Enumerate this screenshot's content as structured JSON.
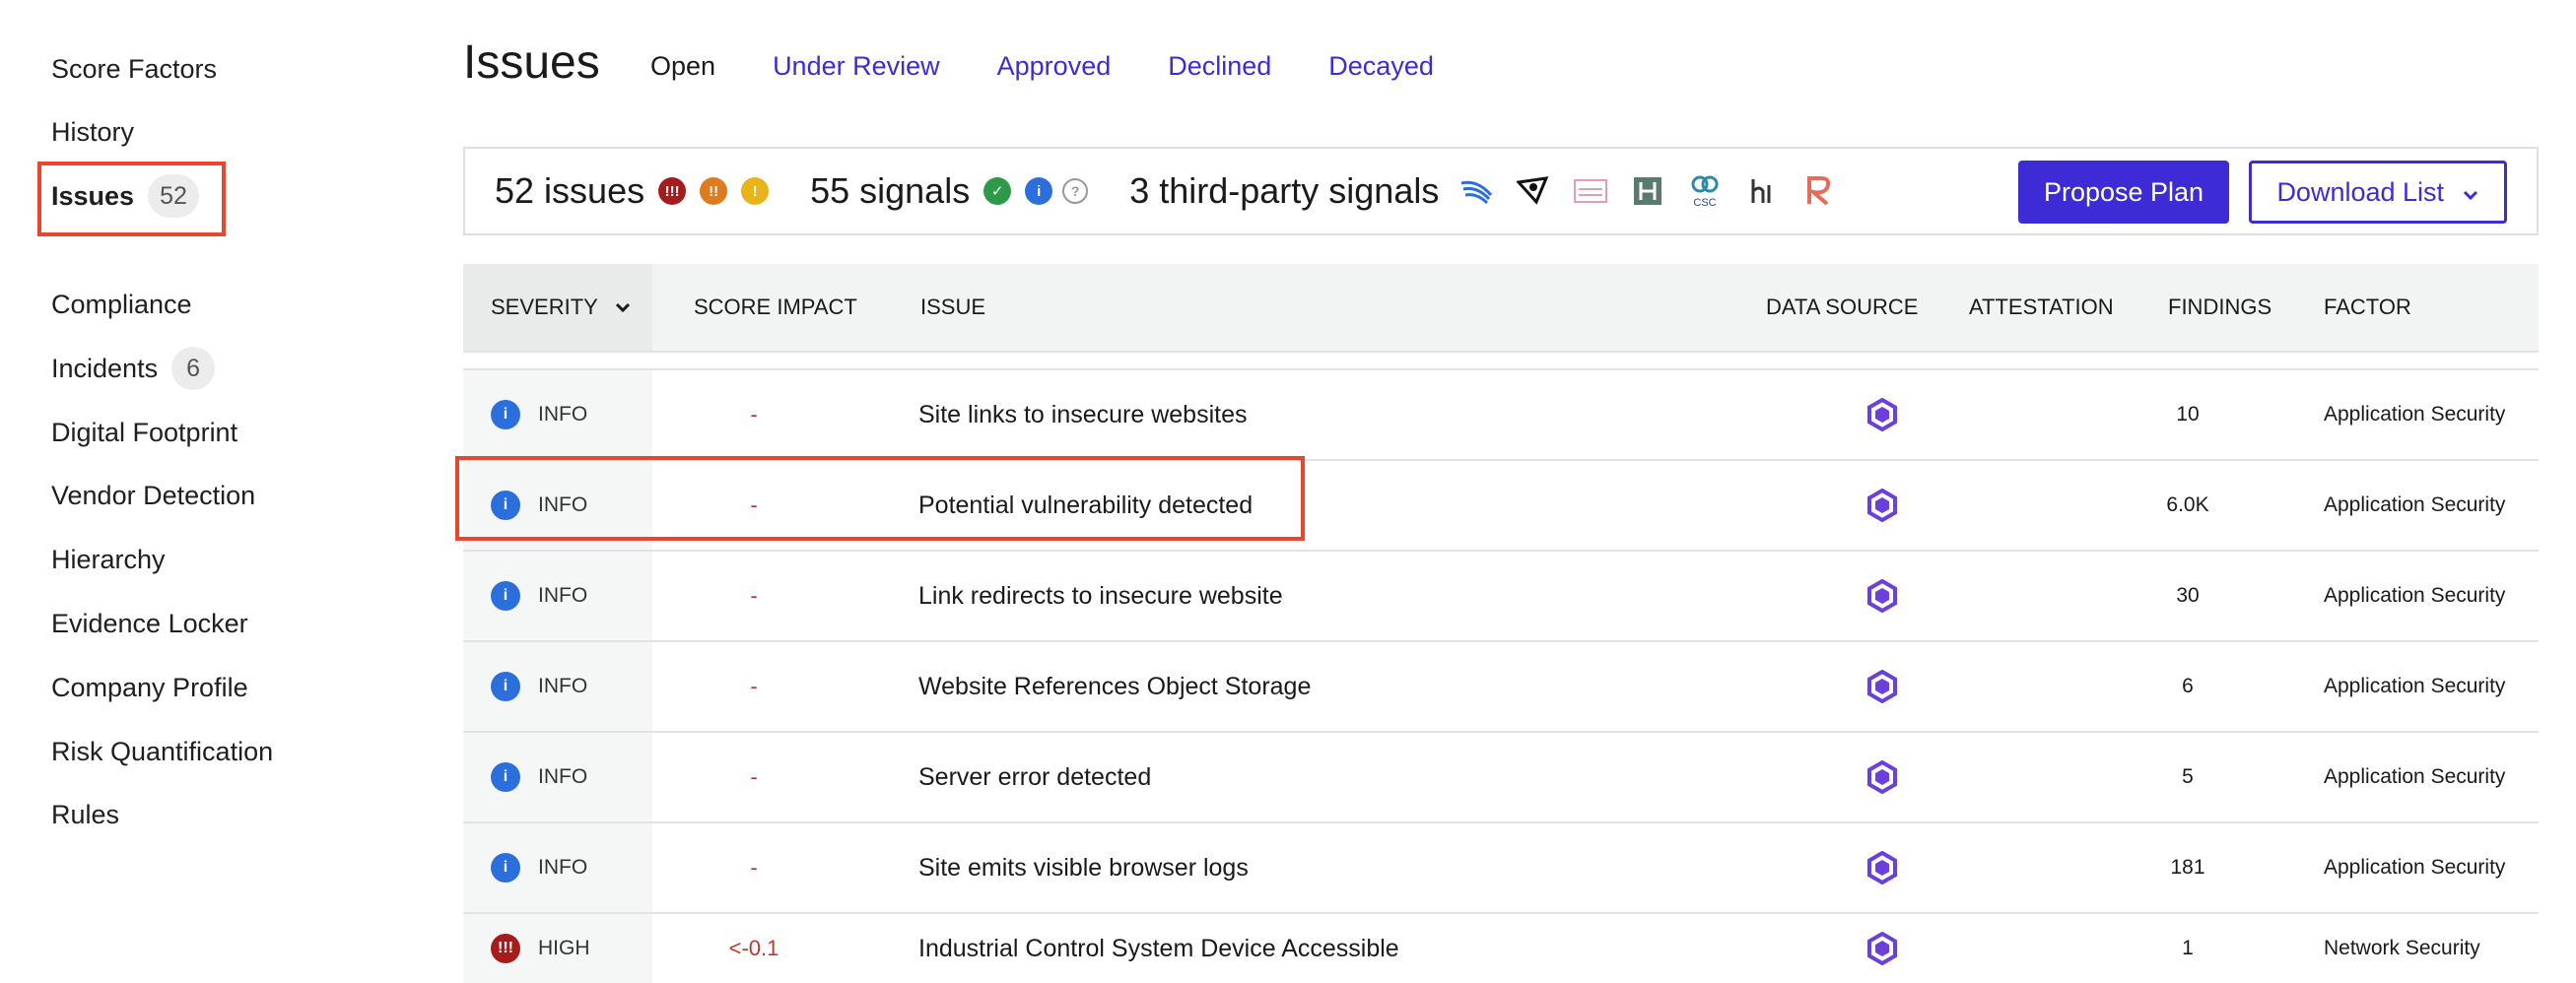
{
  "sidebar": {
    "items": [
      {
        "label": "Score Factors"
      },
      {
        "label": "History"
      },
      {
        "label": "Issues",
        "badge": "52"
      },
      {
        "label": "Compliance"
      },
      {
        "label": "Incidents",
        "badge": "6"
      },
      {
        "label": "Digital Footprint"
      },
      {
        "label": "Vendor Detection"
      },
      {
        "label": "Hierarchy"
      },
      {
        "label": "Evidence Locker"
      },
      {
        "label": "Company Profile"
      },
      {
        "label": "Risk Quantification"
      },
      {
        "label": "Rules"
      }
    ]
  },
  "header": {
    "title": "Issues",
    "tabs": [
      "Open",
      "Under Review",
      "Approved",
      "Declined",
      "Decayed"
    ]
  },
  "summary": {
    "issues": "52 issues",
    "signals": "55 signals",
    "third_party": "3 third-party signals",
    "propose_label": "Propose Plan",
    "download_label": "Download List"
  },
  "table": {
    "headers": {
      "severity": "SEVERITY",
      "impact": "SCORE IMPACT",
      "issue": "ISSUE",
      "source": "DATA SOURCE",
      "attestation": "ATTESTATION",
      "findings": "FINDINGS",
      "factor": "FACTOR"
    },
    "rows": [
      {
        "severity": "INFO",
        "impact": "-",
        "issue": "Site links to insecure websites",
        "findings": "10",
        "factor": "Application Security"
      },
      {
        "severity": "INFO",
        "impact": "-",
        "issue": "Potential vulnerability detected",
        "findings": "6.0K",
        "factor": "Application Security"
      },
      {
        "severity": "INFO",
        "impact": "-",
        "issue": "Link redirects to insecure website",
        "findings": "30",
        "factor": "Application Security"
      },
      {
        "severity": "INFO",
        "impact": "-",
        "issue": "Website References Object Storage",
        "findings": "6",
        "factor": "Application Security"
      },
      {
        "severity": "INFO",
        "impact": "-",
        "issue": "Server error detected",
        "findings": "5",
        "factor": "Application Security"
      },
      {
        "severity": "INFO",
        "impact": "-",
        "issue": "Site emits visible browser logs",
        "findings": "181",
        "factor": "Application Security"
      },
      {
        "severity": "HIGH",
        "impact": "<-0.1",
        "issue": "Industrial Control System Device Accessible",
        "findings": "1",
        "factor": "Network Security"
      }
    ]
  },
  "colors": {
    "accent": "#3d2bd6",
    "highlight": "#e8462f",
    "high": "#a61c1c",
    "info": "#2a6fdb"
  }
}
